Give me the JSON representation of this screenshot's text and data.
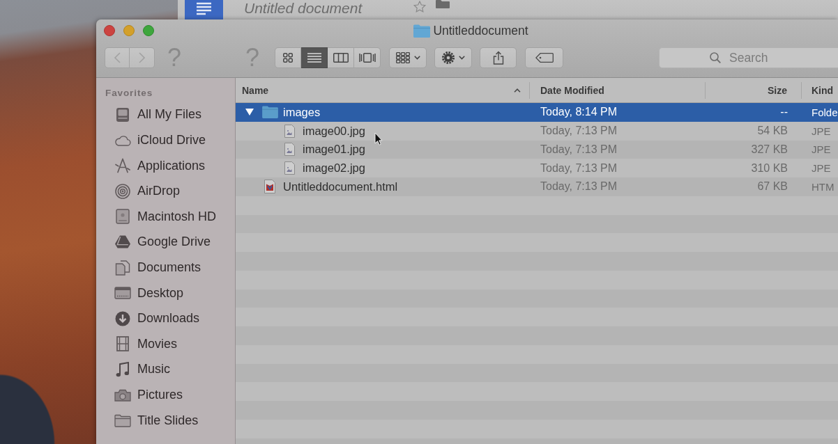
{
  "background_window": {
    "title": "Untitled document"
  },
  "window": {
    "title": "Untitleddocument",
    "toolbar": {
      "back": {
        "disabled": true
      },
      "forward": {
        "disabled": true
      },
      "question_marks": [
        "?",
        "?"
      ],
      "views": [
        {
          "kind": "icons",
          "selected": false
        },
        {
          "kind": "list",
          "selected": true
        },
        {
          "kind": "columns",
          "selected": false
        },
        {
          "kind": "coverflow",
          "selected": false
        }
      ],
      "search": {
        "placeholder": "Search"
      }
    },
    "sidebar": {
      "heading": "Favorites",
      "items": [
        {
          "label": "All My Files",
          "kind": "recents",
          "selected": false
        },
        {
          "label": "iCloud Drive",
          "kind": "cloud",
          "selected": false
        },
        {
          "label": "Applications",
          "kind": "applications",
          "selected": false
        },
        {
          "label": "AirDrop",
          "kind": "airdrop",
          "selected": false
        },
        {
          "label": "Macintosh HD",
          "kind": "disk",
          "selected": false
        },
        {
          "label": "Google Drive",
          "kind": "drive",
          "selected": false
        },
        {
          "label": "Documents",
          "kind": "documents",
          "selected": false
        },
        {
          "label": "Desktop",
          "kind": "desktop",
          "selected": false
        },
        {
          "label": "Downloads",
          "kind": "downloads",
          "selected": false
        },
        {
          "label": "Movies",
          "kind": "movies",
          "selected": false
        },
        {
          "label": "Music",
          "kind": "music",
          "selected": false
        },
        {
          "label": "Pictures",
          "kind": "pictures",
          "selected": false
        },
        {
          "label": "Title Slides",
          "kind": "folder",
          "selected": false
        }
      ]
    },
    "file_list": {
      "columns": [
        {
          "label": "Name",
          "sorted": true
        },
        {
          "label": "Date Modified",
          "sorted": false
        },
        {
          "label": "Size",
          "sorted": false
        },
        {
          "label": "Kind",
          "sorted": false
        }
      ],
      "rows": [
        {
          "name": "images",
          "kind": "folder",
          "date_modified": "Today, 8:14 PM",
          "size": "--",
          "file_kind": "Folde",
          "selected": true,
          "expanded": true,
          "children": [
            {
              "name": "image00.jpg",
              "kind": "image",
              "date_modified": "Today, 7:13 PM",
              "size": "54 KB",
              "file_kind": "JPE",
              "selected": false
            },
            {
              "name": "image01.jpg",
              "kind": "image",
              "date_modified": "Today, 7:13 PM",
              "size": "327 KB",
              "file_kind": "JPE",
              "selected": false
            },
            {
              "name": "image02.jpg",
              "kind": "image",
              "date_modified": "Today, 7:13 PM",
              "size": "310 KB",
              "file_kind": "JPE",
              "selected": false
            }
          ]
        },
        {
          "name": "Untitleddocument.html",
          "kind": "html",
          "date_modified": "Today, 7:13 PM",
          "size": "67 KB",
          "file_kind": "HTM",
          "selected": false
        }
      ]
    }
  }
}
